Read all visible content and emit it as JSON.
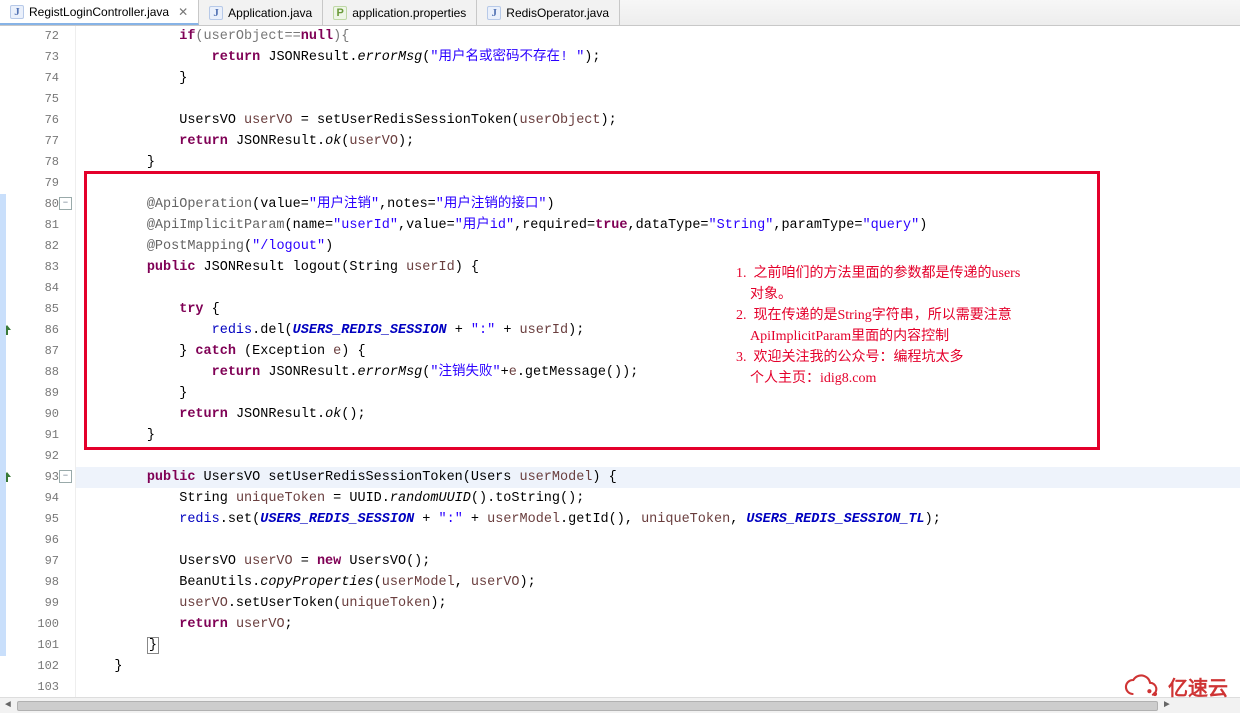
{
  "tabs": [
    {
      "label": "RegistLoginController.java",
      "icon": "J",
      "active": true
    },
    {
      "label": "Application.java",
      "icon": "J",
      "active": false
    },
    {
      "label": "application.properties",
      "icon": "P",
      "active": false
    },
    {
      "label": "RedisOperator.java",
      "icon": "J",
      "active": false
    }
  ],
  "line_start": 72,
  "line_end": 103,
  "override_markers": [
    86,
    93
  ],
  "fold_markers": [
    80,
    93
  ],
  "highlight_line": 93,
  "change_bar_ranges": [
    [
      80,
      101
    ]
  ],
  "red_box": {
    "first_line": 79,
    "last_line": 91
  },
  "notes": {
    "items": [
      "1.  之前咱们的方法里面的参数都是传递的users",
      "    对象。",
      "2.  现在传递的是String字符串，所以需要注意",
      "    ApiImplicitParam里面的内容控制",
      "3.  欢迎关注我的公众号：编程坑太多",
      "    个人主页：idig8.com"
    ]
  },
  "watermark": "亿速云",
  "code": {
    "72": {
      "indent": 3,
      "tokens": [
        {
          "t": "if",
          "c": "kw"
        },
        {
          "t": "(userObject=="
        },
        {
          "t": "null",
          "c": "kw"
        },
        {
          "t": "){"
        }
      ],
      "strike": true
    },
    "73": {
      "indent": 4,
      "tokens": [
        {
          "t": "return ",
          "c": "kw"
        },
        {
          "t": "JSONResult."
        },
        {
          "t": "errorMsg",
          "c": "smethod"
        },
        {
          "t": "("
        },
        {
          "t": "\"用户名或密码不存在! \"",
          "c": "str"
        },
        {
          "t": ");"
        }
      ]
    },
    "74": {
      "indent": 3,
      "tokens": [
        {
          "t": "}"
        }
      ]
    },
    "75": {
      "indent": 0,
      "tokens": []
    },
    "76": {
      "indent": 3,
      "tokens": [
        {
          "t": "UsersVO "
        },
        {
          "t": "userVO",
          "c": "param"
        },
        {
          "t": " = setUserRedisSessionToken("
        },
        {
          "t": "userObject",
          "c": "param"
        },
        {
          "t": ");"
        }
      ]
    },
    "77": {
      "indent": 3,
      "tokens": [
        {
          "t": "return ",
          "c": "kw"
        },
        {
          "t": "JSONResult."
        },
        {
          "t": "ok",
          "c": "smethod"
        },
        {
          "t": "("
        },
        {
          "t": "userVO",
          "c": "param"
        },
        {
          "t": ");"
        }
      ]
    },
    "78": {
      "indent": 2,
      "tokens": [
        {
          "t": "}"
        }
      ]
    },
    "79": {
      "indent": 0,
      "tokens": []
    },
    "80": {
      "indent": 2,
      "tokens": [
        {
          "t": "@ApiOperation",
          "c": "ann-code"
        },
        {
          "t": "(value="
        },
        {
          "t": "\"用户注销\"",
          "c": "str"
        },
        {
          "t": ",notes="
        },
        {
          "t": "\"用户注销的接口\"",
          "c": "str"
        },
        {
          "t": ")"
        }
      ]
    },
    "81": {
      "indent": 2,
      "tokens": [
        {
          "t": "@ApiImplicitParam",
          "c": "ann-code"
        },
        {
          "t": "(name="
        },
        {
          "t": "\"userId\"",
          "c": "str"
        },
        {
          "t": ",value="
        },
        {
          "t": "\"用户id\"",
          "c": "str"
        },
        {
          "t": ",required="
        },
        {
          "t": "true",
          "c": "kw"
        },
        {
          "t": ",dataType="
        },
        {
          "t": "\"String\"",
          "c": "str"
        },
        {
          "t": ",paramType="
        },
        {
          "t": "\"query\"",
          "c": "str"
        },
        {
          "t": ")"
        }
      ]
    },
    "82": {
      "indent": 2,
      "tokens": [
        {
          "t": "@PostMapping",
          "c": "ann-code"
        },
        {
          "t": "("
        },
        {
          "t": "\"/logout\"",
          "c": "str"
        },
        {
          "t": ")"
        }
      ]
    },
    "83": {
      "indent": 2,
      "tokens": [
        {
          "t": "public ",
          "c": "kw"
        },
        {
          "t": "JSONResult logout(String "
        },
        {
          "t": "userId",
          "c": "param"
        },
        {
          "t": ") {"
        }
      ]
    },
    "84": {
      "indent": 0,
      "tokens": []
    },
    "85": {
      "indent": 3,
      "tokens": [
        {
          "t": "try ",
          "c": "kw"
        },
        {
          "t": "{"
        }
      ]
    },
    "86": {
      "indent": 4,
      "tokens": [
        {
          "t": "redis",
          "c": "field"
        },
        {
          "t": ".del("
        },
        {
          "t": "USERS_REDIS_SESSION",
          "c": "sfield"
        },
        {
          "t": " + "
        },
        {
          "t": "\":\"",
          "c": "str"
        },
        {
          "t": " + "
        },
        {
          "t": "userId",
          "c": "param"
        },
        {
          "t": ");"
        }
      ]
    },
    "87": {
      "indent": 3,
      "tokens": [
        {
          "t": "} "
        },
        {
          "t": "catch ",
          "c": "kw"
        },
        {
          "t": "(Exception "
        },
        {
          "t": "e",
          "c": "param"
        },
        {
          "t": ") {"
        }
      ]
    },
    "88": {
      "indent": 4,
      "tokens": [
        {
          "t": "return ",
          "c": "kw"
        },
        {
          "t": "JSONResult."
        },
        {
          "t": "errorMsg",
          "c": "smethod"
        },
        {
          "t": "("
        },
        {
          "t": "\"注销失败\"",
          "c": "str"
        },
        {
          "t": "+"
        },
        {
          "t": "e",
          "c": "param"
        },
        {
          "t": ".getMessage());"
        }
      ]
    },
    "89": {
      "indent": 3,
      "tokens": [
        {
          "t": "}"
        }
      ]
    },
    "90": {
      "indent": 3,
      "tokens": [
        {
          "t": "return ",
          "c": "kw"
        },
        {
          "t": "JSONResult."
        },
        {
          "t": "ok",
          "c": "smethod"
        },
        {
          "t": "();"
        }
      ]
    },
    "91": {
      "indent": 2,
      "tokens": [
        {
          "t": "}"
        }
      ]
    },
    "92": {
      "indent": 0,
      "tokens": []
    },
    "93": {
      "indent": 2,
      "tokens": [
        {
          "t": "public ",
          "c": "kw"
        },
        {
          "t": "UsersVO setUserRedisSessionToken(Users "
        },
        {
          "t": "userModel",
          "c": "param"
        },
        {
          "t": ") {"
        }
      ]
    },
    "94": {
      "indent": 3,
      "tokens": [
        {
          "t": "String "
        },
        {
          "t": "uniqueToken",
          "c": "param"
        },
        {
          "t": " = UUID."
        },
        {
          "t": "randomUUID",
          "c": "smethod"
        },
        {
          "t": "().toString();"
        }
      ]
    },
    "95": {
      "indent": 3,
      "tokens": [
        {
          "t": "redis",
          "c": "field"
        },
        {
          "t": ".set("
        },
        {
          "t": "USERS_REDIS_SESSION",
          "c": "sfield"
        },
        {
          "t": " + "
        },
        {
          "t": "\":\"",
          "c": "str"
        },
        {
          "t": " + "
        },
        {
          "t": "userModel",
          "c": "param"
        },
        {
          "t": ".getId(), "
        },
        {
          "t": "uniqueToken",
          "c": "param"
        },
        {
          "t": ", "
        },
        {
          "t": "USERS_REDIS_SESSION_TL",
          "c": "sfield"
        },
        {
          "t": ");"
        }
      ]
    },
    "96": {
      "indent": 0,
      "tokens": []
    },
    "97": {
      "indent": 3,
      "tokens": [
        {
          "t": "UsersVO "
        },
        {
          "t": "userVO",
          "c": "param"
        },
        {
          "t": " = "
        },
        {
          "t": "new ",
          "c": "kw"
        },
        {
          "t": "UsersVO();"
        }
      ]
    },
    "98": {
      "indent": 3,
      "tokens": [
        {
          "t": "BeanUtils."
        },
        {
          "t": "copyProperties",
          "c": "smethod"
        },
        {
          "t": "("
        },
        {
          "t": "userModel",
          "c": "param"
        },
        {
          "t": ", "
        },
        {
          "t": "userVO",
          "c": "param"
        },
        {
          "t": ");"
        }
      ]
    },
    "99": {
      "indent": 3,
      "tokens": [
        {
          "t": "userVO",
          "c": "param"
        },
        {
          "t": ".setUserToken("
        },
        {
          "t": "uniqueToken",
          "c": "param"
        },
        {
          "t": ");"
        }
      ]
    },
    "100": {
      "indent": 3,
      "tokens": [
        {
          "t": "return ",
          "c": "kw"
        },
        {
          "t": "userVO",
          "c": "param"
        },
        {
          "t": ";"
        }
      ]
    },
    "101": {
      "indent": 2,
      "tokens": [
        {
          "t": "}"
        }
      ],
      "boxchar": true
    },
    "102": {
      "indent": 1,
      "tokens": [
        {
          "t": "}"
        }
      ]
    },
    "103": {
      "indent": 0,
      "tokens": []
    }
  }
}
